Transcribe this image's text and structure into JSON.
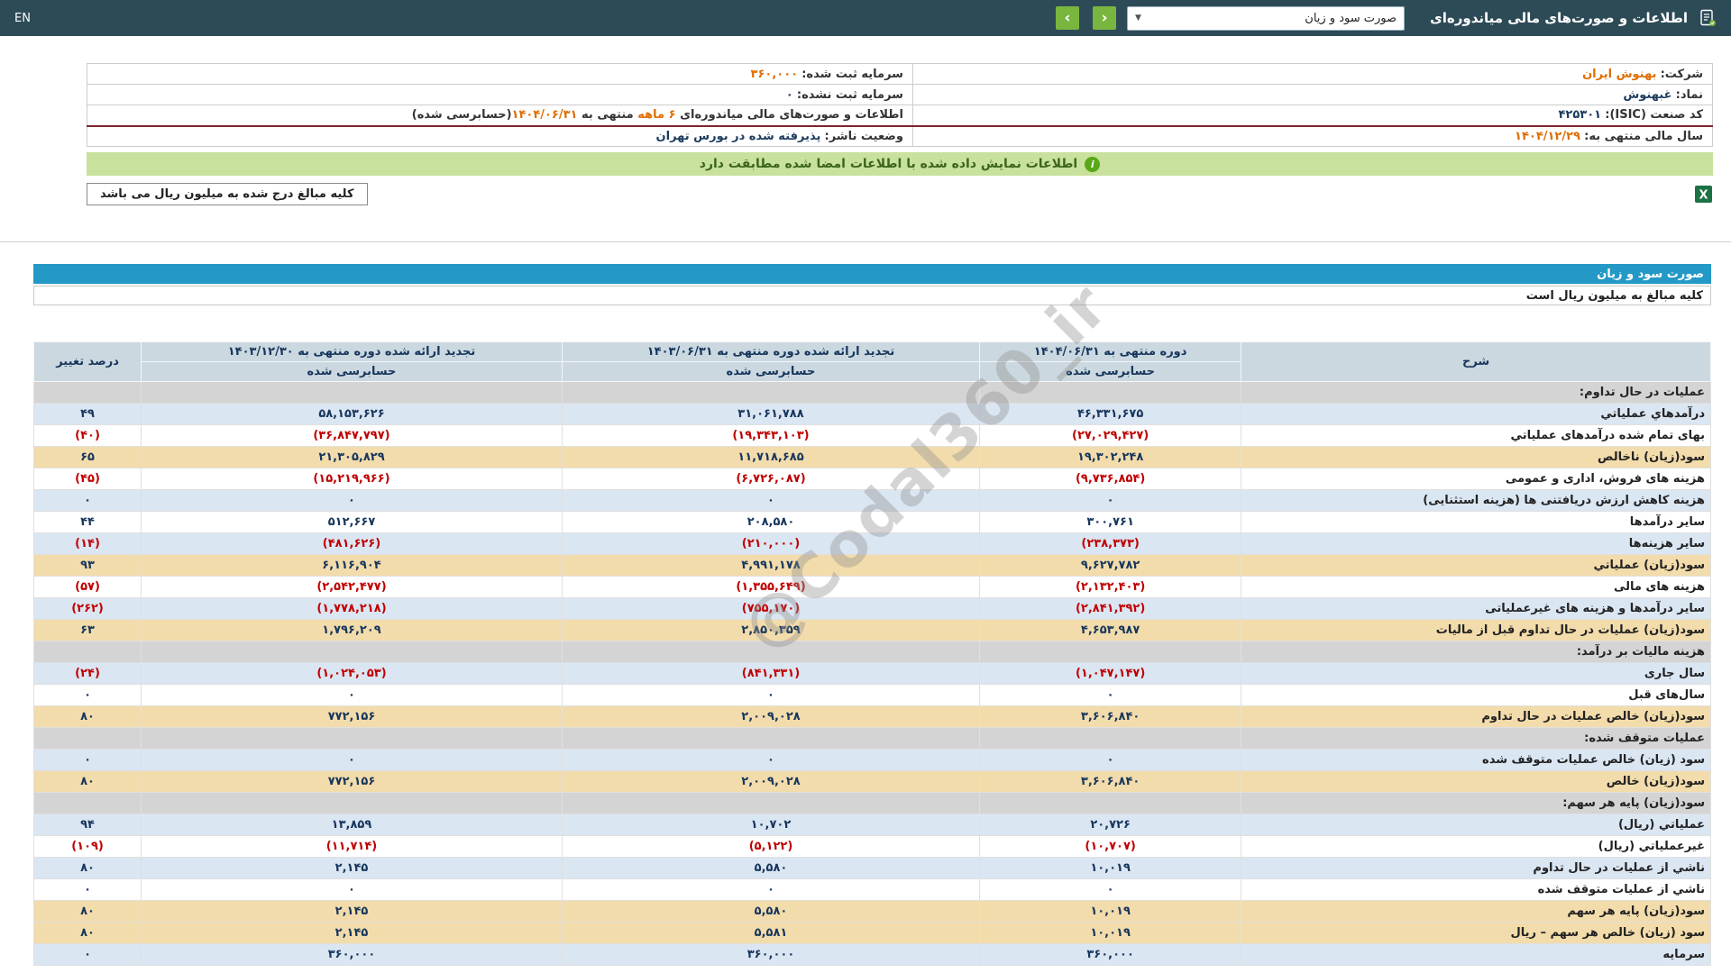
{
  "header": {
    "title": "اطلاعات و صورت‌های مالی میاندوره‌ای",
    "report_select_value": "صورت سود و زیان",
    "caret": "▼",
    "prev_glyph": "‹",
    "next_glyph": "›",
    "lang_link": "EN"
  },
  "company_info": {
    "row1": {
      "right_label": "شرکت:",
      "right_value": "بهنوش ایران",
      "left_label": "سرمایه ثبت شده:",
      "left_value": "۳۶۰,۰۰۰"
    },
    "row2": {
      "right_label": "نماد:",
      "right_value": "غبهنوش",
      "left_label": "سرمایه ثبت نشده:",
      "left_value": "۰"
    },
    "row3": {
      "right_label": "کد صنعت (ISIC):",
      "right_value": "۴۲۵۳۰۱",
      "period_p1": "اطلاعات و صورت‌های مالی میاندوره‌ای ",
      "period_months": "۶ ماهه",
      "period_p2": " منتهی به ",
      "period_date": "۱۴۰۴/۰۶/۳۱",
      "period_p3": "(حسابرسی شده)"
    },
    "row4": {
      "right_label": "سال مالی منتهی به:",
      "right_value": "۱۴۰۴/۱۲/۲۹",
      "left_label": "وضعیت ناشر:",
      "left_value": "پذیرفته شده در بورس تهران"
    }
  },
  "banner": {
    "text": "اطلاعات نمایش داده شده با اطلاعات امضا شده مطابقت دارد",
    "icon_glyph": "i"
  },
  "tools": {
    "note": "کلیه مبالغ درج شده به میلیون ریال می باشد",
    "excel_icon": "excel-export"
  },
  "watermark": "@Codal360_ir",
  "table": {
    "title": "صورت سود و زیان",
    "units_note": "کلیه مبالغ به میلیون ریال است",
    "columns": {
      "desc": "شرح",
      "col1": "دوره منتهی به ۱۴۰۴/۰۶/۳۱",
      "col2": "تجدید ارائه شده دوره منتهی به ۱۴۰۳/۰۶/۳۱",
      "col3": "تجدید ارائه شده دوره منتهی به ۱۴۰۳/۱۲/۳۰",
      "audited": "حسابرسی شده",
      "pct": "درصد تغییر"
    },
    "rows": [
      {
        "type": "section",
        "label": "عملیات در حال تداوم:"
      },
      {
        "type": "blue",
        "label": "درآمدهاي عملياتي",
        "v1": "۴۶,۳۳۱,۶۷۵",
        "v2": "۳۱,۰۶۱,۷۸۸",
        "v3": "۵۸,۱۵۳,۶۲۶",
        "pct": "۴۹"
      },
      {
        "type": "white",
        "label": "بهای تمام شده درآمدهای عملیاتي",
        "v1": "(۲۷,۰۲۹,۴۲۷)",
        "v2": "(۱۹,۳۴۳,۱۰۳)",
        "v3": "(۳۶,۸۴۷,۷۹۷)",
        "pct": "(۴۰)"
      },
      {
        "type": "yellow",
        "label": "سود(زيان) ناخالص",
        "v1": "۱۹,۳۰۲,۲۴۸",
        "v2": "۱۱,۷۱۸,۶۸۵",
        "v3": "۲۱,۳۰۵,۸۲۹",
        "pct": "۶۵"
      },
      {
        "type": "white",
        "label": "هزینه های فروش، اداری و عمومی",
        "v1": "(۹,۷۳۶,۸۵۴)",
        "v2": "(۶,۷۲۶,۰۸۷)",
        "v3": "(۱۵,۲۱۹,۹۶۶)",
        "pct": "(۴۵)"
      },
      {
        "type": "blue",
        "label": "هزینه کاهش ارزش دریافتنی ها (هزینه استثنایی)",
        "v1": "۰",
        "v2": "۰",
        "v3": "۰",
        "pct": "۰"
      },
      {
        "type": "white",
        "label": "سایر درآمدها",
        "v1": "۳۰۰,۷۶۱",
        "v2": "۲۰۸,۵۸۰",
        "v3": "۵۱۲,۶۶۷",
        "pct": "۴۴"
      },
      {
        "type": "blue",
        "label": "سایر هزینه‌ها",
        "v1": "(۲۳۸,۳۷۳)",
        "v2": "(۲۱۰,۰۰۰)",
        "v3": "(۴۸۱,۶۲۶)",
        "pct": "(۱۴)"
      },
      {
        "type": "yellow",
        "label": "سود(زيان) عملياتي",
        "v1": "۹,۶۲۷,۷۸۲",
        "v2": "۴,۹۹۱,۱۷۸",
        "v3": "۶,۱۱۶,۹۰۴",
        "pct": "۹۳"
      },
      {
        "type": "white",
        "label": "هزینه های مالی",
        "v1": "(۲,۱۳۲,۴۰۳)",
        "v2": "(۱,۳۵۵,۶۴۹)",
        "v3": "(۲,۵۴۲,۴۷۷)",
        "pct": "(۵۷)"
      },
      {
        "type": "blue",
        "label": "سایر درآمدها و هزینه های غیرعملیاتی",
        "v1": "(۲,۸۴۱,۳۹۲)",
        "v2": "(۷۵۵,۱۷۰)",
        "v3": "(۱,۷۷۸,۲۱۸)",
        "pct": "(۲۶۲)"
      },
      {
        "type": "yellow",
        "label": "سود(زيان) عمليات در حال تداوم قبل از ماليات",
        "v1": "۴,۶۵۳,۹۸۷",
        "v2": "۲,۸۵۰,۳۵۹",
        "v3": "۱,۷۹۶,۲۰۹",
        "pct": "۶۳"
      },
      {
        "type": "section",
        "label": "هزينه ماليات بر درآمد:"
      },
      {
        "type": "blue",
        "label": "سال جاری",
        "v1": "(۱,۰۴۷,۱۴۷)",
        "v2": "(۸۴۱,۳۳۱)",
        "v3": "(۱,۰۲۴,۰۵۳)",
        "pct": "(۲۴)"
      },
      {
        "type": "white",
        "label": "سال‌های قبل",
        "v1": "۰",
        "v2": "۰",
        "v3": "۰",
        "pct": "۰"
      },
      {
        "type": "yellow",
        "label": "سود(زيان) خالص عمليات در حال تداوم",
        "v1": "۳,۶۰۶,۸۴۰",
        "v2": "۲,۰۰۹,۰۲۸",
        "v3": "۷۷۲,۱۵۶",
        "pct": "۸۰"
      },
      {
        "type": "section",
        "label": "عملیات متوقف شده:"
      },
      {
        "type": "blue",
        "label": "سود (زیان) خالص عملیات متوقف شده",
        "v1": "۰",
        "v2": "۰",
        "v3": "۰",
        "pct": "۰"
      },
      {
        "type": "yellow",
        "label": "سود(زیان) خالص",
        "v1": "۳,۶۰۶,۸۴۰",
        "v2": "۲,۰۰۹,۰۲۸",
        "v3": "۷۷۲,۱۵۶",
        "pct": "۸۰"
      },
      {
        "type": "section",
        "label": "سود(زیان) پایه هر سهم:"
      },
      {
        "type": "blue",
        "label": "عملياتي (ريال)",
        "v1": "۲۰,۷۲۶",
        "v2": "۱۰,۷۰۲",
        "v3": "۱۳,۸۵۹",
        "pct": "۹۴"
      },
      {
        "type": "white",
        "label": "غیرعملیاتي (ریال)",
        "v1": "(۱۰,۷۰۷)",
        "v2": "(۵,۱۲۲)",
        "v3": "(۱۱,۷۱۴)",
        "pct": "(۱۰۹)"
      },
      {
        "type": "blue",
        "label": "ناشي از عمليات در حال تداوم",
        "v1": "۱۰,۰۱۹",
        "v2": "۵,۵۸۰",
        "v3": "۲,۱۴۵",
        "pct": "۸۰"
      },
      {
        "type": "white",
        "label": "ناشي از عمليات متوقف شده",
        "v1": "۰",
        "v2": "۰",
        "v3": "۰",
        "pct": "۰"
      },
      {
        "type": "yellow",
        "label": "سود(زيان) پايه هر سهم",
        "v1": "۱۰,۰۱۹",
        "v2": "۵,۵۸۰",
        "v3": "۲,۱۴۵",
        "pct": "۸۰"
      },
      {
        "type": "yellow",
        "label": "سود (زيان) خالص هر سهم – ريال",
        "v1": "۱۰,۰۱۹",
        "v2": "۵,۵۸۱",
        "v3": "۲,۱۴۵",
        "pct": "۸۰"
      },
      {
        "type": "blue",
        "label": "سرمایه",
        "v1": "۳۶۰,۰۰۰",
        "v2": "۳۶۰,۰۰۰",
        "v3": "۳۶۰,۰۰۰",
        "pct": "۰"
      }
    ]
  },
  "colors": {
    "topbar_bg": "#2d4b57",
    "nav_button_green": "#79b63f",
    "accent_orange": "#e06d00",
    "banner_green_bg": "#c8e19c",
    "banner_green_text": "#3c651c",
    "title_bar_blue": "#2499c6",
    "row_blue": "#dbe6f3",
    "row_yellow": "#f3dcab",
    "row_section_gray": "#d4d4d4",
    "negative_red": "#c00000",
    "value_navy": "#17365d",
    "red_separator": "#7e2430",
    "excel_green": "#1e7145"
  }
}
